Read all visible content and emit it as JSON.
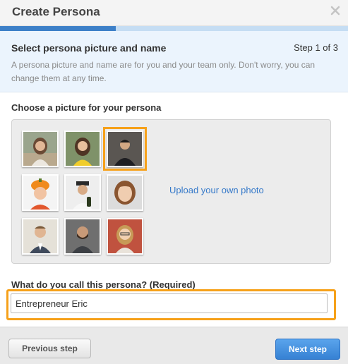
{
  "dialog": {
    "title": "Create Persona",
    "close_icon": "close-x-icon",
    "progress_fraction": 0.333
  },
  "step": {
    "heading": "Select persona picture and name",
    "counter": "Step 1 of 3",
    "description": "A persona picture and name are for you and your team only. Don't worry, you can change them at any time."
  },
  "picture": {
    "label": "Choose a picture for your persona",
    "upload_link": "Upload your own photo",
    "selected_index": 2,
    "photos": [
      "woman-outdoors",
      "woman-yellow-top",
      "man-dark-hoodie",
      "boy-pumpkin-hat",
      "man-with-bottle",
      "woman-brown-hair",
      "man-suit",
      "man-beard",
      "woman-glasses"
    ]
  },
  "name": {
    "label": "What do you call this persona? (Required)",
    "value": "Entrepreneur Eric"
  },
  "footer": {
    "prev_label": "Previous step",
    "next_label": "Next step"
  },
  "colors": {
    "accent_orange": "#f6a11a",
    "link_blue": "#3579c9",
    "primary_blue": "#3681d3"
  }
}
